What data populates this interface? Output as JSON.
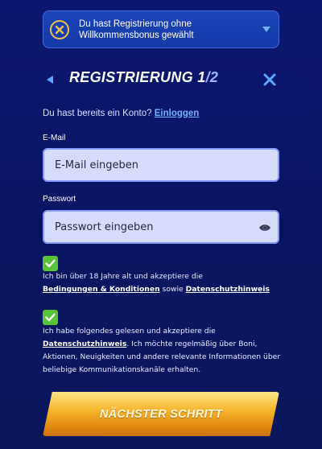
{
  "bonus_dropdown": {
    "line1": "Du hast Registrierung ohne",
    "line2": "Willkommensbonus gewählt",
    "icon": "no-bonus-icon"
  },
  "header": {
    "title_main": "REGISTRIERUNG 1",
    "title_total": "/2",
    "back_icon": "back-arrow-icon",
    "close_icon": "close-icon"
  },
  "login": {
    "prompt": "Du hast bereits ein Konto?",
    "link": "Einloggen"
  },
  "email": {
    "label": "E-Mail",
    "placeholder": "E-Mail eingeben",
    "value": ""
  },
  "password": {
    "label": "Passwort",
    "placeholder": "Passwort eingeben",
    "value": "",
    "toggle_icon": "eye-icon"
  },
  "consent_age": {
    "checked": true,
    "text_before": "Ich bin über 18 Jahre alt und akzeptiere die",
    "link_terms": "Bedingungen & Konditionen",
    "text_middle": "sowie",
    "link_privacy": "Datenschutzhinweis"
  },
  "consent_marketing": {
    "checked": true,
    "text_before": "Ich habe folgendes gelesen und akzeptiere die",
    "link_privacy": "Datenschutzhinweis",
    "text_after": ". Ich möchte regelmäßig über Boni, Aktionen, Neuigkeiten und andere relevante Informationen über beliebige Kommunikationskanäle erhalten."
  },
  "next_button": {
    "label": "NÄCHSTER SCHRITT"
  },
  "colors": {
    "background": "#0b1670",
    "accent_blue": "#6fb4ff",
    "input_bg": "#d7dcff",
    "checkbox_green": "#57c43a",
    "button_gold": "#f6b830"
  }
}
